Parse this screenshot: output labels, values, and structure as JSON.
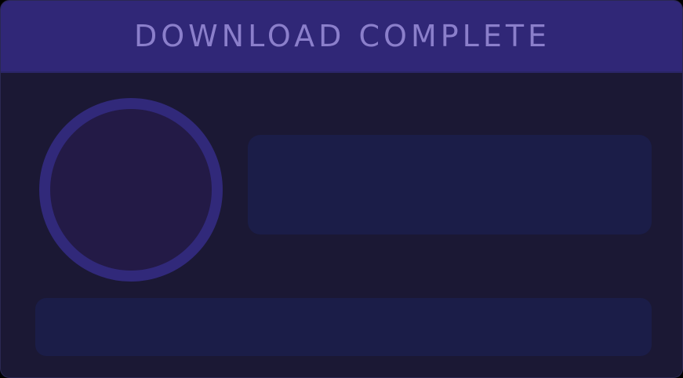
{
  "window": {
    "title": "DOWNLOAD COMPLETE"
  },
  "colors": {
    "header_background": "#302777",
    "title_text": "#8b7fcb",
    "panel_background": "#1b1834",
    "placeholder_block": "#1b1d48",
    "ring": "#31297a",
    "ring_fill": "#231a46"
  },
  "content": {
    "avatar": {
      "icon": "empty-circle-placeholder"
    }
  }
}
